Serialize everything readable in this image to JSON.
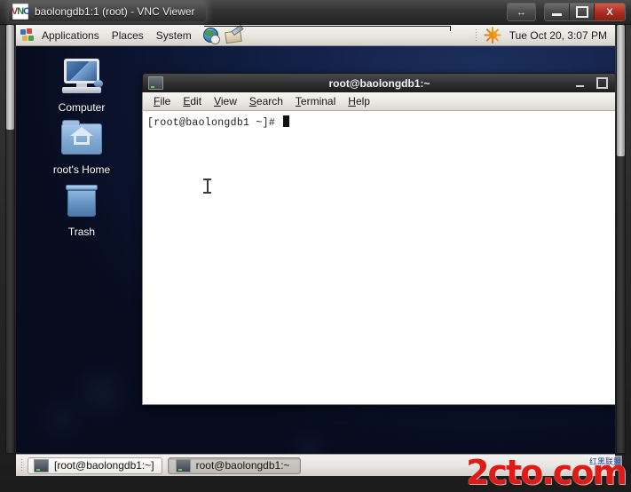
{
  "vnc_window": {
    "title": "baolongdb1:1 (root) - VNC Viewer",
    "logo_letters": {
      "v": "V",
      "n": "N",
      "c": "C"
    },
    "controls": {
      "resize_label": "↔",
      "minimize_label": "",
      "maximize_label": "",
      "close_label": "X"
    }
  },
  "gnome_panel": {
    "menus": [
      {
        "label": "Applications"
      },
      {
        "label": "Places"
      },
      {
        "label": "System"
      }
    ],
    "launchers": [
      {
        "name": "web-browser"
      },
      {
        "name": "email-client"
      }
    ],
    "clock": "Tue Oct 20,  3:07 PM"
  },
  "desktop": {
    "icons": [
      {
        "label": "Computer",
        "icon": "computer-icon"
      },
      {
        "label": "root's Home",
        "icon": "home-folder-icon"
      },
      {
        "label": "Trash",
        "icon": "trash-icon"
      }
    ],
    "background_color": "#14224a"
  },
  "terminal": {
    "title": "root@baolongdb1:~",
    "menus": [
      {
        "mnemonic": "F",
        "rest": "ile"
      },
      {
        "mnemonic": "E",
        "rest": "dit"
      },
      {
        "mnemonic": "V",
        "rest": "iew"
      },
      {
        "mnemonic": "S",
        "rest": "earch"
      },
      {
        "mnemonic": "T",
        "rest": "erminal"
      },
      {
        "mnemonic": "H",
        "rest": "elp"
      }
    ],
    "prompt": "[root@baolongdb1 ~]# ",
    "background_color": "#ffffff",
    "text_color": "#1c1c1c"
  },
  "taskbar": {
    "buttons": [
      {
        "label": "[root@baolongdb1:~]",
        "state": "inactive"
      },
      {
        "label": "root@baolongdb1:~",
        "state": "active"
      }
    ]
  },
  "watermark": {
    "text": "2cto.com",
    "subtext": "红黑联盟",
    "color": "#e01b16"
  }
}
